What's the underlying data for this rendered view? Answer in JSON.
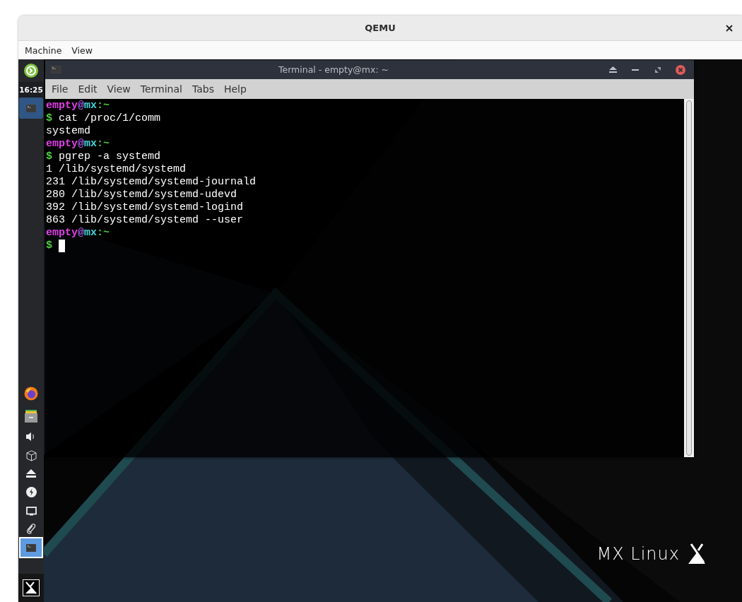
{
  "window": {
    "title": "QEMU"
  },
  "menu": [
    "Machine",
    "View"
  ],
  "panel": {
    "clock": "16:25"
  },
  "terminal": {
    "title": "Terminal - empty@mx: ~",
    "menu": [
      "File",
      "Edit",
      "View",
      "Terminal",
      "Tabs",
      "Help"
    ],
    "lines": [
      {
        "kind": "prompt",
        "user": "empty",
        "at": "@",
        "host": "mx",
        "path": ":~"
      },
      {
        "kind": "command",
        "sign": "$",
        "text": "cat /proc/1/comm"
      },
      {
        "kind": "output",
        "text": "systemd"
      },
      {
        "kind": "prompt",
        "user": "empty",
        "at": "@",
        "host": "mx",
        "path": ":~"
      },
      {
        "kind": "command",
        "sign": "$",
        "text": "pgrep -a systemd"
      },
      {
        "kind": "output",
        "text": "1 /lib/systemd/systemd"
      },
      {
        "kind": "output",
        "text": "231 /lib/systemd/systemd-journald"
      },
      {
        "kind": "output",
        "text": "280 /lib/systemd/systemd-udevd"
      },
      {
        "kind": "output",
        "text": "392 /lib/systemd/systemd-logind"
      },
      {
        "kind": "output",
        "text": "863 /lib/systemd/systemd --user"
      },
      {
        "kind": "prompt",
        "user": "empty",
        "at": "@",
        "host": "mx",
        "path": ":~"
      },
      {
        "kind": "input",
        "sign": "$"
      }
    ]
  },
  "desktop": {
    "logo": "MX Linux"
  }
}
